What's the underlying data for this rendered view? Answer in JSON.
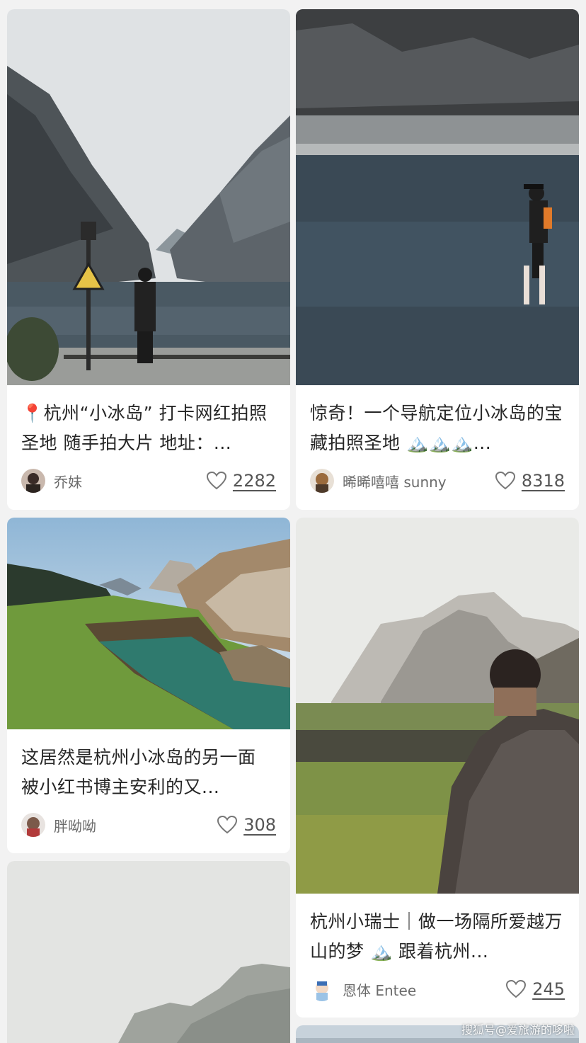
{
  "feed": {
    "cards": [
      {
        "title": "📍杭州“小冰岛” 打卡网红拍照圣地 随手拍大片 地址：...",
        "author": "乔妹",
        "likes": "2282",
        "image": "mountain-lake-woman-lamp"
      },
      {
        "title": "惊奇！一个导航定位小冰岛的宝藏拍照圣地 🏔️🏔️🏔️...",
        "author": "晞晞嘻嘻 sunny",
        "likes": "8318",
        "image": "cliff-water-woman-hat"
      },
      {
        "title": "这居然是杭州小冰岛的另一面 被小红书博主安利的又...",
        "author": "胖呦呦",
        "likes": "308",
        "image": "green-grass-lake-cliffs"
      },
      {
        "title": "杭州小瑞士｜做一场隔所爱越万山的梦 🏔️ 跟着杭州...",
        "author": "恩体 Entee",
        "likes": "245",
        "image": "grass-rock-man-back"
      },
      {
        "title": "",
        "author": "",
        "likes": "",
        "image": "misty-mountain"
      }
    ]
  },
  "watermark": "搜狐号@爱旅游的哆啦"
}
